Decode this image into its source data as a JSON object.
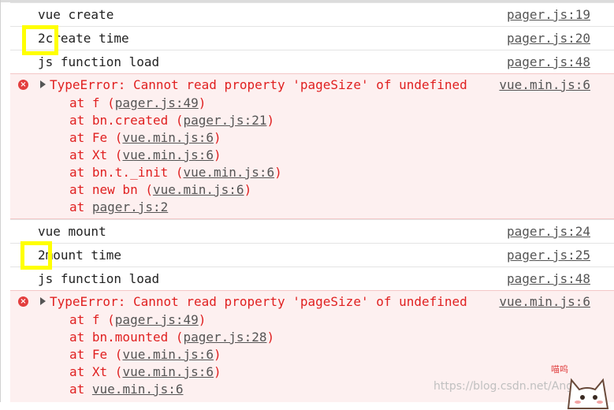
{
  "logs": [
    {
      "msg": "vue create",
      "src": "pager.js:19"
    },
    {
      "msg": "2create time",
      "src": "pager.js:20"
    },
    {
      "msg": "js function load",
      "src": "pager.js:48"
    },
    {
      "msg": "vue mount",
      "src": "pager.js:24"
    },
    {
      "msg": "2mount time",
      "src": "pager.js:25"
    },
    {
      "msg": "js function load",
      "src": "pager.js:48"
    }
  ],
  "errors": [
    {
      "head": "TypeError: Cannot read property 'pageSize' of undefined",
      "src": "vue.min.js:6",
      "frames": [
        {
          "pre": "at f (",
          "link": "pager.js:49",
          "post": ")"
        },
        {
          "pre": "at bn.created (",
          "link": "pager.js:21",
          "post": ")"
        },
        {
          "pre": "at Fe (",
          "link": "vue.min.js:6",
          "post": ")"
        },
        {
          "pre": "at Xt (",
          "link": "vue.min.js:6",
          "post": ")"
        },
        {
          "pre": "at bn.t._init (",
          "link": "vue.min.js:6",
          "post": ")"
        },
        {
          "pre": "at new bn (",
          "link": "vue.min.js:6",
          "post": ")"
        },
        {
          "pre": "at ",
          "link": "pager.js:2",
          "post": ""
        }
      ]
    },
    {
      "head": "TypeError: Cannot read property 'pageSize' of undefined",
      "src": "vue.min.js:6",
      "frames": [
        {
          "pre": "at f (",
          "link": "pager.js:49",
          "post": ")"
        },
        {
          "pre": "at bn.mounted (",
          "link": "pager.js:28",
          "post": ")"
        },
        {
          "pre": "at Fe (",
          "link": "vue.min.js:6",
          "post": ")"
        },
        {
          "pre": "at Xt (",
          "link": "vue.min.js:6",
          "post": ")"
        },
        {
          "pre": "at ",
          "link": "vue.min.js:6",
          "post": ""
        }
      ]
    }
  ],
  "error_icon": "error-circle-icon",
  "expand_icon": "expand-triangle-icon",
  "highlight_color": "#ffff00",
  "watermark": "https://blog.csdn.net/Ang…",
  "sticker_text": "喵呜"
}
